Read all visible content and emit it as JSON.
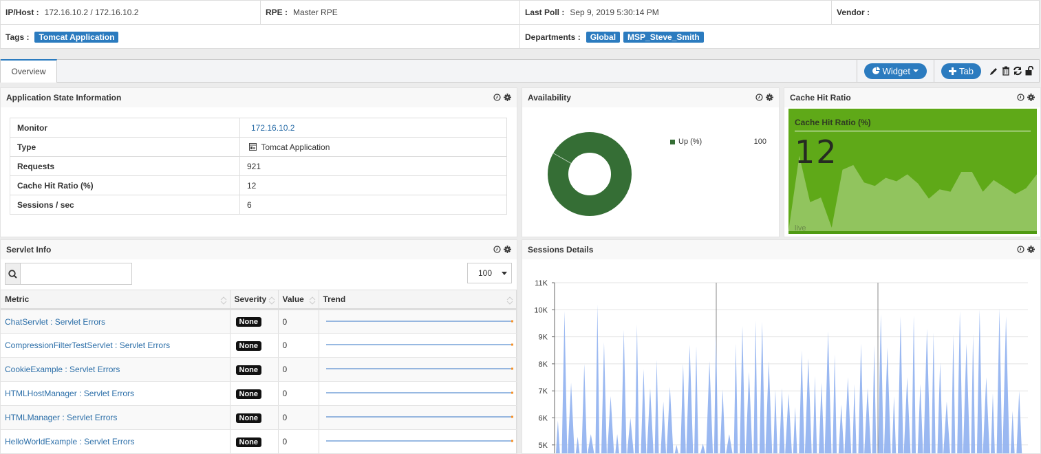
{
  "info": {
    "ip_host_label": "IP/Host :",
    "ip_host_value": "172.16.10.2 / 172.16.10.2",
    "rpe_label": "RPE :",
    "rpe_value": "Master RPE",
    "last_poll_label": "Last Poll :",
    "last_poll_value": "Sep 9, 2019 5:30:14 PM",
    "vendor_label": "Vendor :",
    "vendor_value": "",
    "tags_label": "Tags :",
    "tags": [
      "Tomcat Application"
    ],
    "departments_label": "Departments :",
    "departments": [
      "Global",
      "MSP_Steve_Smith"
    ]
  },
  "tabs": {
    "items": [
      {
        "label": "Overview",
        "active": true
      }
    ],
    "widget_button": "Widget",
    "tab_button": "Tab",
    "icons": [
      "pencil-icon",
      "trash-icon",
      "refresh-icon",
      "unlock-icon"
    ]
  },
  "app_state": {
    "title": "Application State Information",
    "rows": [
      {
        "key": "Monitor",
        "value": "172.16.10.2",
        "link": true
      },
      {
        "key": "Type",
        "value": "Tomcat Application",
        "icon": "app-type-icon"
      },
      {
        "key": "Requests",
        "value": "921"
      },
      {
        "key": "Cache Hit Ratio (%)",
        "value": "12"
      },
      {
        "key": "Sessions / sec",
        "value": "6"
      }
    ]
  },
  "availability": {
    "title": "Availability",
    "legend_label": "Up (%)",
    "legend_value": "100",
    "color": "#356e35"
  },
  "cache_hit": {
    "title": "Cache Hit Ratio",
    "inner_title": "Cache Hit Ratio (%)",
    "value": "12",
    "live_label": "live",
    "bg_color": "#5fa918",
    "area_color": "#91c45e",
    "sparkline": [
      0,
      65,
      25,
      29,
      3,
      53,
      57,
      42,
      39,
      46,
      43,
      49,
      41,
      28,
      36,
      34,
      51,
      51,
      34,
      44,
      38,
      32,
      37,
      49
    ]
  },
  "servlet": {
    "title": "Servlet Info",
    "search_placeholder": "",
    "page_size": "100",
    "columns": [
      "Metric",
      "Severity",
      "Value",
      "Trend"
    ],
    "rows": [
      {
        "metric": "ChatServlet : Servlet Errors",
        "severity": "None",
        "value": "0"
      },
      {
        "metric": "CompressionFilterTestServlet : Servlet Errors",
        "severity": "None",
        "value": "0"
      },
      {
        "metric": "CookieExample : Servlet Errors",
        "severity": "None",
        "value": "0"
      },
      {
        "metric": "HTMLHostManager : Servlet Errors",
        "severity": "None",
        "value": "0"
      },
      {
        "metric": "HTMLManager : Servlet Errors",
        "severity": "None",
        "value": "0"
      },
      {
        "metric": "HelloWorldExample : Servlet Errors",
        "severity": "None",
        "value": "0"
      }
    ]
  },
  "sessions": {
    "title": "Sessions Details"
  },
  "chart_data": [
    {
      "type": "pie",
      "title": "Availability",
      "categories": [
        "Up (%)"
      ],
      "values": [
        100
      ],
      "legend": "right"
    },
    {
      "type": "area",
      "title": "Cache Hit Ratio (%)",
      "values": [
        0,
        65,
        25,
        29,
        3,
        53,
        57,
        42,
        39,
        46,
        43,
        49,
        41,
        28,
        36,
        34,
        51,
        51,
        34,
        44,
        38,
        32,
        37,
        49
      ]
    },
    {
      "type": "area",
      "title": "Sessions Details",
      "ylabel": "",
      "ylim": [
        4800,
        11000
      ],
      "yticks": [
        "5K",
        "6K",
        "7K",
        "8K",
        "9K",
        "10K",
        "11K"
      ],
      "grid": true,
      "peaks": [
        5900,
        9950,
        7300,
        5300,
        8000,
        5400,
        10200,
        8800,
        6800,
        5400,
        9250,
        6000,
        9450,
        7800,
        7100,
        8150,
        6600,
        7150,
        5000,
        8000,
        8700,
        8650,
        5050,
        8100,
        9100,
        7050,
        5400,
        8750,
        9400,
        7700,
        9600,
        9550,
        8100,
        7050,
        7100,
        6900,
        6400,
        8500,
        8200,
        7550,
        7300,
        9200,
        8350,
        6500,
        7500,
        7250,
        8750,
        7100,
        8700,
        9850,
        8600,
        6800,
        9750,
        7500,
        9800,
        7250,
        9300,
        9150,
        8050,
        6600,
        9100,
        9950,
        8750,
        9100,
        10000,
        7500,
        6900,
        10050,
        9750,
        6250,
        7000
      ]
    }
  ]
}
